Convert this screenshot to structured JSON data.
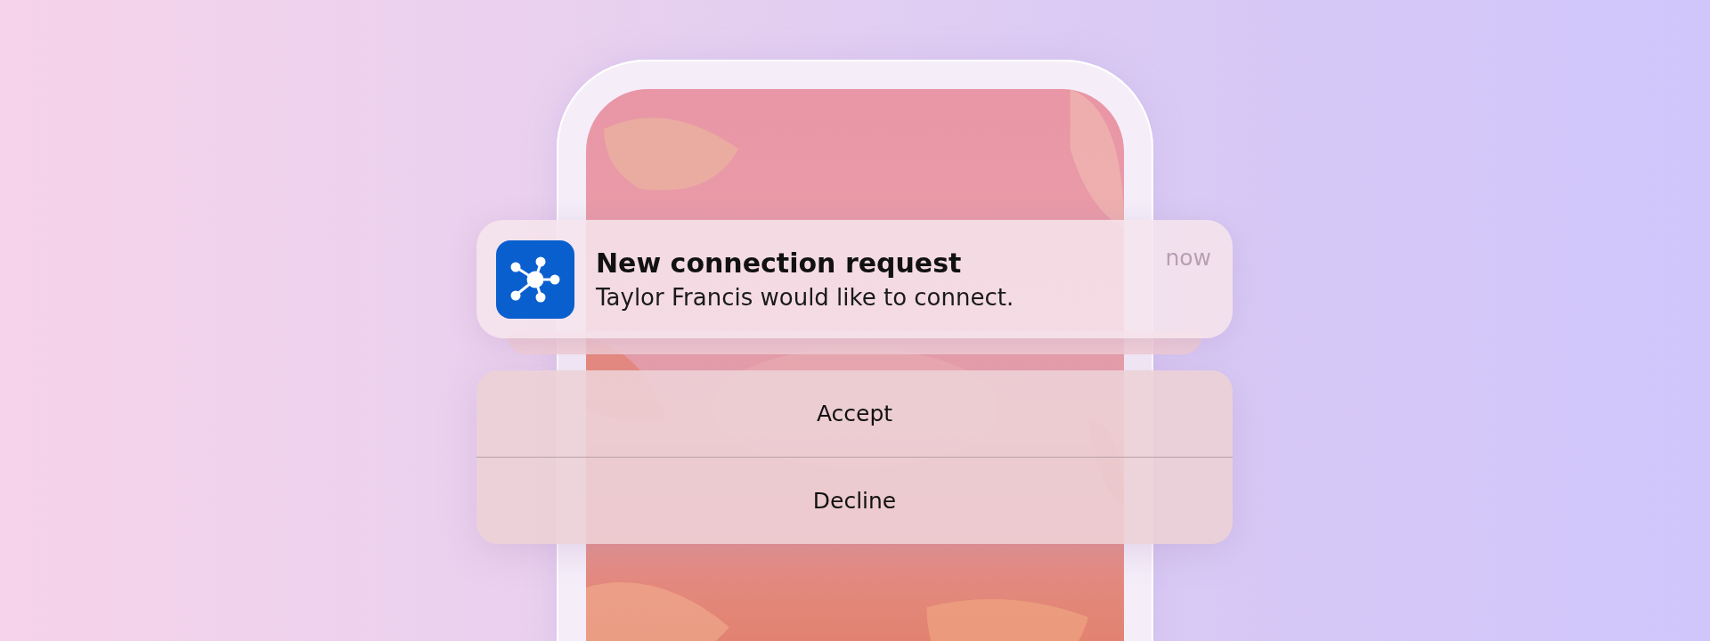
{
  "notification": {
    "title": "New connection request",
    "body": "Taylor Francis would like to connect.",
    "time": "now",
    "stacked": true
  },
  "actions": [
    {
      "label": "Accept"
    },
    {
      "label": "Decline"
    }
  ]
}
